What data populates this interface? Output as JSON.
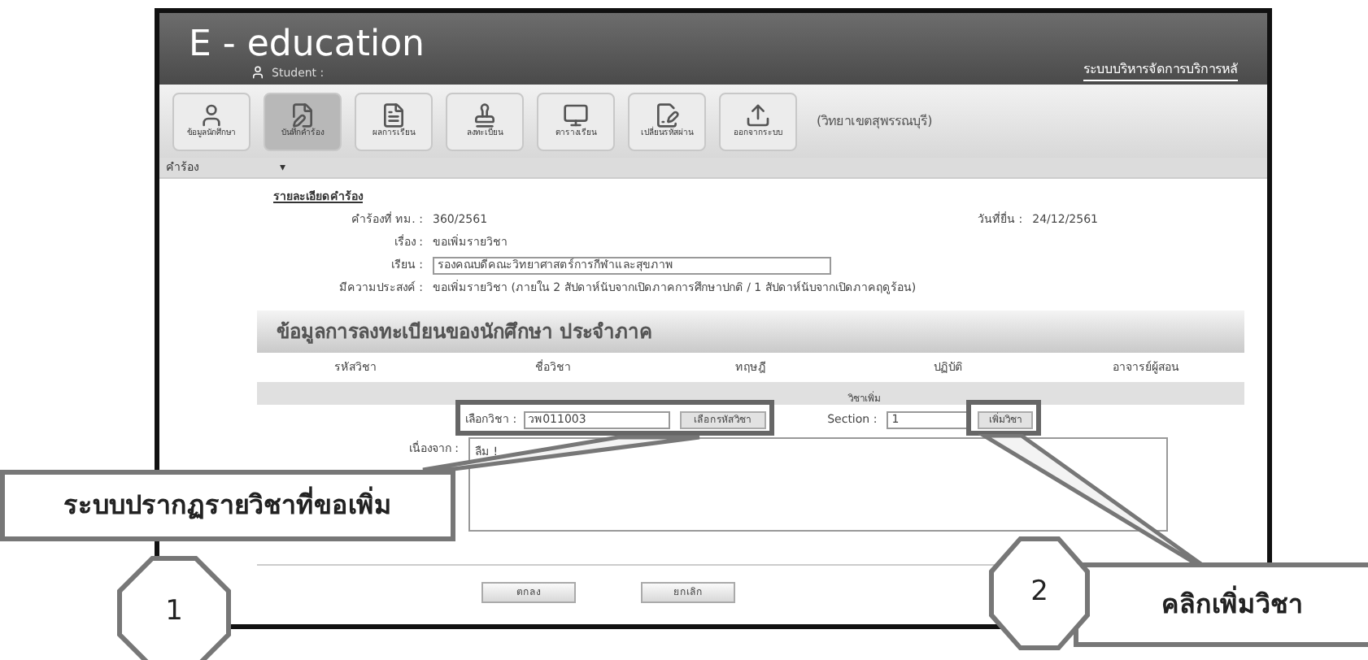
{
  "header": {
    "title": "E - education",
    "user": "Student :",
    "system_title": "ระบบบริหารจัดการบริการหลั"
  },
  "toolbar": {
    "items": [
      {
        "kind": "user",
        "label": "ข้อมูลนักศึกษา",
        "selected": false
      },
      {
        "kind": "edit",
        "label": "บันทึกคำร้อง",
        "selected": true
      },
      {
        "kind": "doc",
        "label": "ผลการเรียน",
        "selected": false
      },
      {
        "kind": "stamp",
        "label": "ลงทะเบียน",
        "selected": false
      },
      {
        "kind": "screen",
        "label": "ตารางเรียน",
        "selected": false
      },
      {
        "kind": "sign",
        "label": "เปลี่ยนรหัสผ่าน",
        "selected": false
      },
      {
        "kind": "upload",
        "label": "ออกจากระบบ",
        "selected": false
      }
    ],
    "campus": "(วิทยาเขตสุพรรณบุรี)"
  },
  "menu": {
    "label": "คำร้อง",
    "caret": "▾"
  },
  "request": {
    "title": "รายละเอียดคำร้อง",
    "fields": [
      {
        "kind": "text",
        "label": "คำร้องที่ ทม. :",
        "value": "360/2561",
        "aside_label": "วันที่ยื่น :",
        "aside_value": "24/12/2561"
      },
      {
        "kind": "text",
        "label": "เรื่อง :",
        "value": "ขอเพิ่มรายวิชา"
      },
      {
        "kind": "input",
        "label": "เรียน :",
        "value": "รองคณบดีคณะวิทยาศาสตร์การกีฬาและสุขภาพ"
      },
      {
        "kind": "text",
        "label": "มีความประสงค์ :",
        "value": "ขอเพิ่มรายวิชา (ภายใน 2 สัปดาห์นับจากเปิดภาคการศึกษาปกติ / 1 สัปดาห์นับจากเปิดภาคฤดูร้อน)"
      }
    ]
  },
  "registration": {
    "title": "ข้อมูลการลงทะเบียนของนักศึกษา ประจำภาค",
    "columns": [
      "รหัสวิชา",
      "ชื่อวิชา",
      "ทฤษฎี",
      "ปฏิบัติ",
      "อาจารย์ผู้สอน"
    ],
    "add_title": "วิชาเพิ่ม",
    "course_label": "เลือกวิชา :",
    "course_value": "วพ011003",
    "choose_button": "เลือกรหัสวิชา",
    "section_label": "Section :",
    "section_value": "1",
    "add_button": "เพิ่มวิชา",
    "reason_label": "เนื่องจาก :",
    "reason_value": "ลืม !"
  },
  "buttons": [
    "ตกลง",
    "ยกเลิก"
  ],
  "callouts": [
    {
      "number": "1",
      "text": "ระบบปรากฏรายวิชาที่ขอเพิ่ม"
    },
    {
      "number": "2",
      "text": "คลิกเพิ่มวิชา"
    }
  ]
}
